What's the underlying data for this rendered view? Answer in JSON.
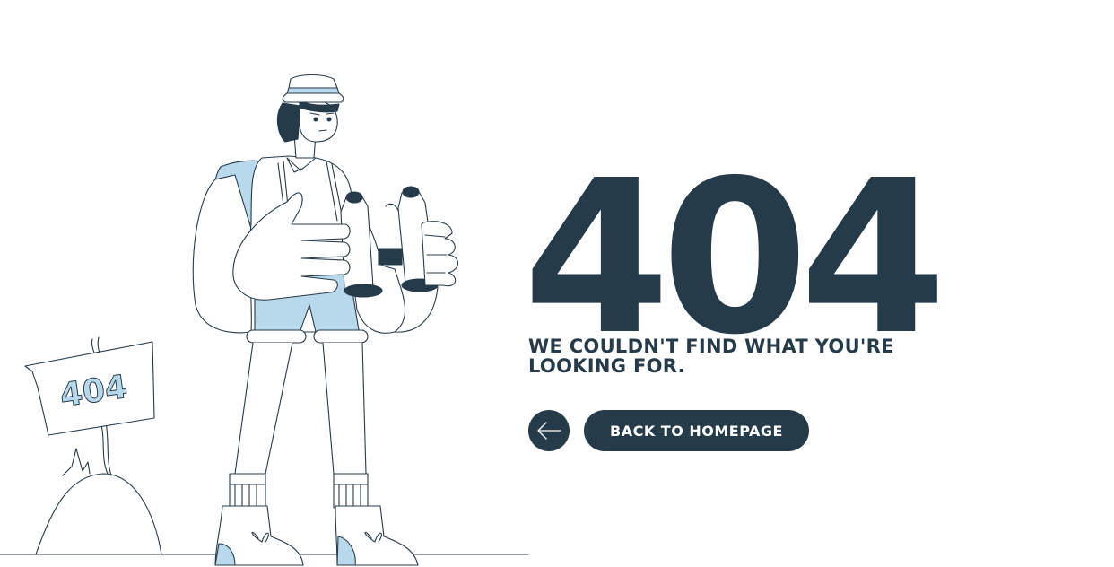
{
  "error": {
    "code": "404",
    "message": "WE COULDN'T FIND WHAT YOU'RE LOOKING FOR."
  },
  "actions": {
    "back_icon": "arrow-left-icon",
    "home_label": "BACK TO HOMEPAGE"
  },
  "illustration": {
    "sign_text": "404"
  },
  "colors": {
    "primary": "#263b4a",
    "accent": "#b8d8ec",
    "background": "#ffffff",
    "line": "#263b4a"
  }
}
